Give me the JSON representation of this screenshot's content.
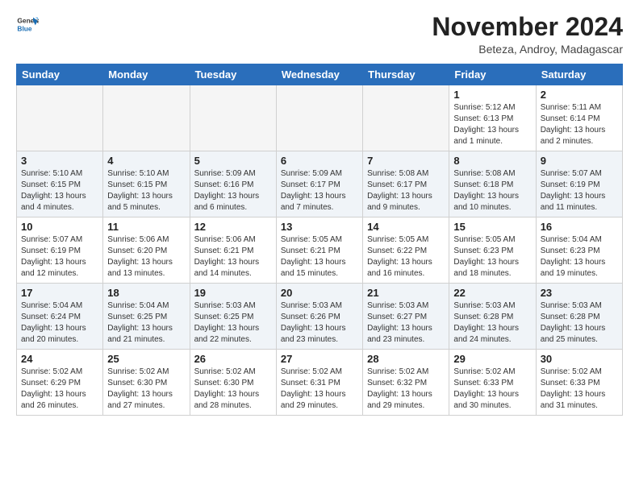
{
  "header": {
    "logo": {
      "general": "General",
      "blue": "Blue"
    },
    "title": "November 2024",
    "location": "Beteza, Androy, Madagascar"
  },
  "calendar": {
    "days_of_week": [
      "Sunday",
      "Monday",
      "Tuesday",
      "Wednesday",
      "Thursday",
      "Friday",
      "Saturday"
    ],
    "weeks": [
      [
        {
          "day": "",
          "info": ""
        },
        {
          "day": "",
          "info": ""
        },
        {
          "day": "",
          "info": ""
        },
        {
          "day": "",
          "info": ""
        },
        {
          "day": "",
          "info": ""
        },
        {
          "day": "1",
          "info": "Sunrise: 5:12 AM\nSunset: 6:13 PM\nDaylight: 13 hours\nand 1 minute."
        },
        {
          "day": "2",
          "info": "Sunrise: 5:11 AM\nSunset: 6:14 PM\nDaylight: 13 hours\nand 2 minutes."
        }
      ],
      [
        {
          "day": "3",
          "info": "Sunrise: 5:10 AM\nSunset: 6:15 PM\nDaylight: 13 hours\nand 4 minutes."
        },
        {
          "day": "4",
          "info": "Sunrise: 5:10 AM\nSunset: 6:15 PM\nDaylight: 13 hours\nand 5 minutes."
        },
        {
          "day": "5",
          "info": "Sunrise: 5:09 AM\nSunset: 6:16 PM\nDaylight: 13 hours\nand 6 minutes."
        },
        {
          "day": "6",
          "info": "Sunrise: 5:09 AM\nSunset: 6:17 PM\nDaylight: 13 hours\nand 7 minutes."
        },
        {
          "day": "7",
          "info": "Sunrise: 5:08 AM\nSunset: 6:17 PM\nDaylight: 13 hours\nand 9 minutes."
        },
        {
          "day": "8",
          "info": "Sunrise: 5:08 AM\nSunset: 6:18 PM\nDaylight: 13 hours\nand 10 minutes."
        },
        {
          "day": "9",
          "info": "Sunrise: 5:07 AM\nSunset: 6:19 PM\nDaylight: 13 hours\nand 11 minutes."
        }
      ],
      [
        {
          "day": "10",
          "info": "Sunrise: 5:07 AM\nSunset: 6:19 PM\nDaylight: 13 hours\nand 12 minutes."
        },
        {
          "day": "11",
          "info": "Sunrise: 5:06 AM\nSunset: 6:20 PM\nDaylight: 13 hours\nand 13 minutes."
        },
        {
          "day": "12",
          "info": "Sunrise: 5:06 AM\nSunset: 6:21 PM\nDaylight: 13 hours\nand 14 minutes."
        },
        {
          "day": "13",
          "info": "Sunrise: 5:05 AM\nSunset: 6:21 PM\nDaylight: 13 hours\nand 15 minutes."
        },
        {
          "day": "14",
          "info": "Sunrise: 5:05 AM\nSunset: 6:22 PM\nDaylight: 13 hours\nand 16 minutes."
        },
        {
          "day": "15",
          "info": "Sunrise: 5:05 AM\nSunset: 6:23 PM\nDaylight: 13 hours\nand 18 minutes."
        },
        {
          "day": "16",
          "info": "Sunrise: 5:04 AM\nSunset: 6:23 PM\nDaylight: 13 hours\nand 19 minutes."
        }
      ],
      [
        {
          "day": "17",
          "info": "Sunrise: 5:04 AM\nSunset: 6:24 PM\nDaylight: 13 hours\nand 20 minutes."
        },
        {
          "day": "18",
          "info": "Sunrise: 5:04 AM\nSunset: 6:25 PM\nDaylight: 13 hours\nand 21 minutes."
        },
        {
          "day": "19",
          "info": "Sunrise: 5:03 AM\nSunset: 6:25 PM\nDaylight: 13 hours\nand 22 minutes."
        },
        {
          "day": "20",
          "info": "Sunrise: 5:03 AM\nSunset: 6:26 PM\nDaylight: 13 hours\nand 23 minutes."
        },
        {
          "day": "21",
          "info": "Sunrise: 5:03 AM\nSunset: 6:27 PM\nDaylight: 13 hours\nand 23 minutes."
        },
        {
          "day": "22",
          "info": "Sunrise: 5:03 AM\nSunset: 6:28 PM\nDaylight: 13 hours\nand 24 minutes."
        },
        {
          "day": "23",
          "info": "Sunrise: 5:03 AM\nSunset: 6:28 PM\nDaylight: 13 hours\nand 25 minutes."
        }
      ],
      [
        {
          "day": "24",
          "info": "Sunrise: 5:02 AM\nSunset: 6:29 PM\nDaylight: 13 hours\nand 26 minutes."
        },
        {
          "day": "25",
          "info": "Sunrise: 5:02 AM\nSunset: 6:30 PM\nDaylight: 13 hours\nand 27 minutes."
        },
        {
          "day": "26",
          "info": "Sunrise: 5:02 AM\nSunset: 6:30 PM\nDaylight: 13 hours\nand 28 minutes."
        },
        {
          "day": "27",
          "info": "Sunrise: 5:02 AM\nSunset: 6:31 PM\nDaylight: 13 hours\nand 29 minutes."
        },
        {
          "day": "28",
          "info": "Sunrise: 5:02 AM\nSunset: 6:32 PM\nDaylight: 13 hours\nand 29 minutes."
        },
        {
          "day": "29",
          "info": "Sunrise: 5:02 AM\nSunset: 6:33 PM\nDaylight: 13 hours\nand 30 minutes."
        },
        {
          "day": "30",
          "info": "Sunrise: 5:02 AM\nSunset: 6:33 PM\nDaylight: 13 hours\nand 31 minutes."
        }
      ]
    ]
  }
}
